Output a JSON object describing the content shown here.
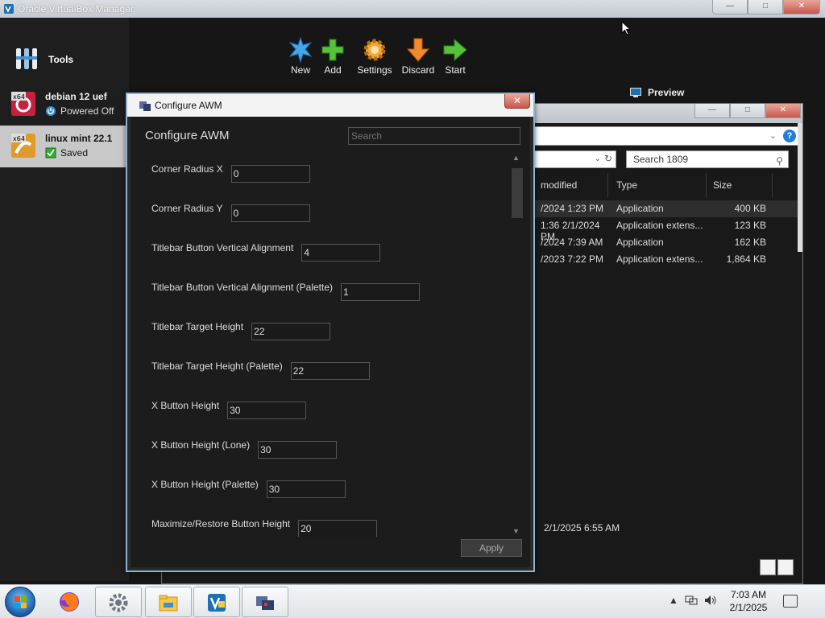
{
  "vbox": {
    "title": "Oracle VirtualBox Manager",
    "tools_label": "Tools",
    "vms": [
      {
        "name": "debian 12 uef",
        "state": "Powered Off",
        "arch": "x64"
      },
      {
        "name": "linux mint 22.1",
        "state": "Saved",
        "arch": "x64"
      }
    ],
    "toolbar": {
      "new": "New",
      "add": "Add",
      "settings": "Settings",
      "discard": "Discard",
      "start": "Start"
    },
    "preview_label": "Preview"
  },
  "explorer": {
    "search_placeholder": "Search 1809",
    "columns": {
      "date": "modified",
      "type": "Type",
      "size": "Size"
    },
    "files": [
      {
        "date": "/2024 1:23 PM",
        "type": "Application",
        "size": "400 KB"
      },
      {
        "date": "2/1/2024 1:36 PM",
        "type": "Application extens...",
        "size": "123 KB"
      },
      {
        "date": "/2024 7:39 AM",
        "type": "Application",
        "size": "162 KB"
      },
      {
        "date": "/2023 7:22 PM",
        "type": "Application extens...",
        "size": "1,864 KB"
      }
    ],
    "bottom_date": "2/1/2025 6:55 AM"
  },
  "dialog": {
    "title": "Configure AWM",
    "heading": "Configure AWM",
    "search_placeholder": "Search",
    "settings": [
      {
        "label": "Corner Radius X",
        "value": "0"
      },
      {
        "label": "Corner Radius Y",
        "value": "0"
      },
      {
        "label": "Titlebar Button Vertical Alignment",
        "value": "4"
      },
      {
        "label": "Titlebar Button Vertical Alignment (Palette)",
        "value": "1"
      },
      {
        "label": "Titlebar Target Height",
        "value": "22"
      },
      {
        "label": "Titlebar Target Height (Palette)",
        "value": "22"
      },
      {
        "label": "X Button Height",
        "value": "30"
      },
      {
        "label": "X Button Height (Lone)",
        "value": "30"
      },
      {
        "label": "X Button Height (Palette)",
        "value": "30"
      },
      {
        "label": "Maximize/Restore Button Height",
        "value": "20"
      }
    ],
    "apply_label": "Apply"
  },
  "taskbar": {
    "time": "7:03 AM",
    "date": "2/1/2025"
  },
  "colors": {
    "vbox_selection": "#c8c8c8",
    "dialog_border": "#8fb3cf",
    "close_button": "#c9574a"
  }
}
